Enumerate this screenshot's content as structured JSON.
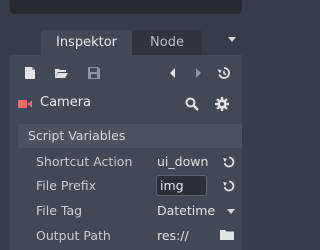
{
  "tabs": {
    "inspector": "Inspektor",
    "node": "Node"
  },
  "object": {
    "name": "Camera"
  },
  "section": {
    "title": "Script Variables"
  },
  "properties": [
    {
      "label": "Shortcut Action",
      "value": "ui_down"
    },
    {
      "label": "File Prefix",
      "value": "img"
    },
    {
      "label": "File Tag",
      "value": "Datetime"
    },
    {
      "label": "Output Path",
      "value": "res://"
    }
  ],
  "colors": {
    "background": "#363d4a",
    "panel": "#414956",
    "section": "#4b5361",
    "camera_icon": "#f06c6c"
  },
  "icons": [
    "new-resource-icon",
    "open-resource-icon",
    "save-resource-icon",
    "history-back-icon",
    "history-forward-icon",
    "object-history-icon",
    "camera-icon",
    "search-icon",
    "gear-icon",
    "revert-icon",
    "dropdown-icon",
    "folder-icon"
  ]
}
